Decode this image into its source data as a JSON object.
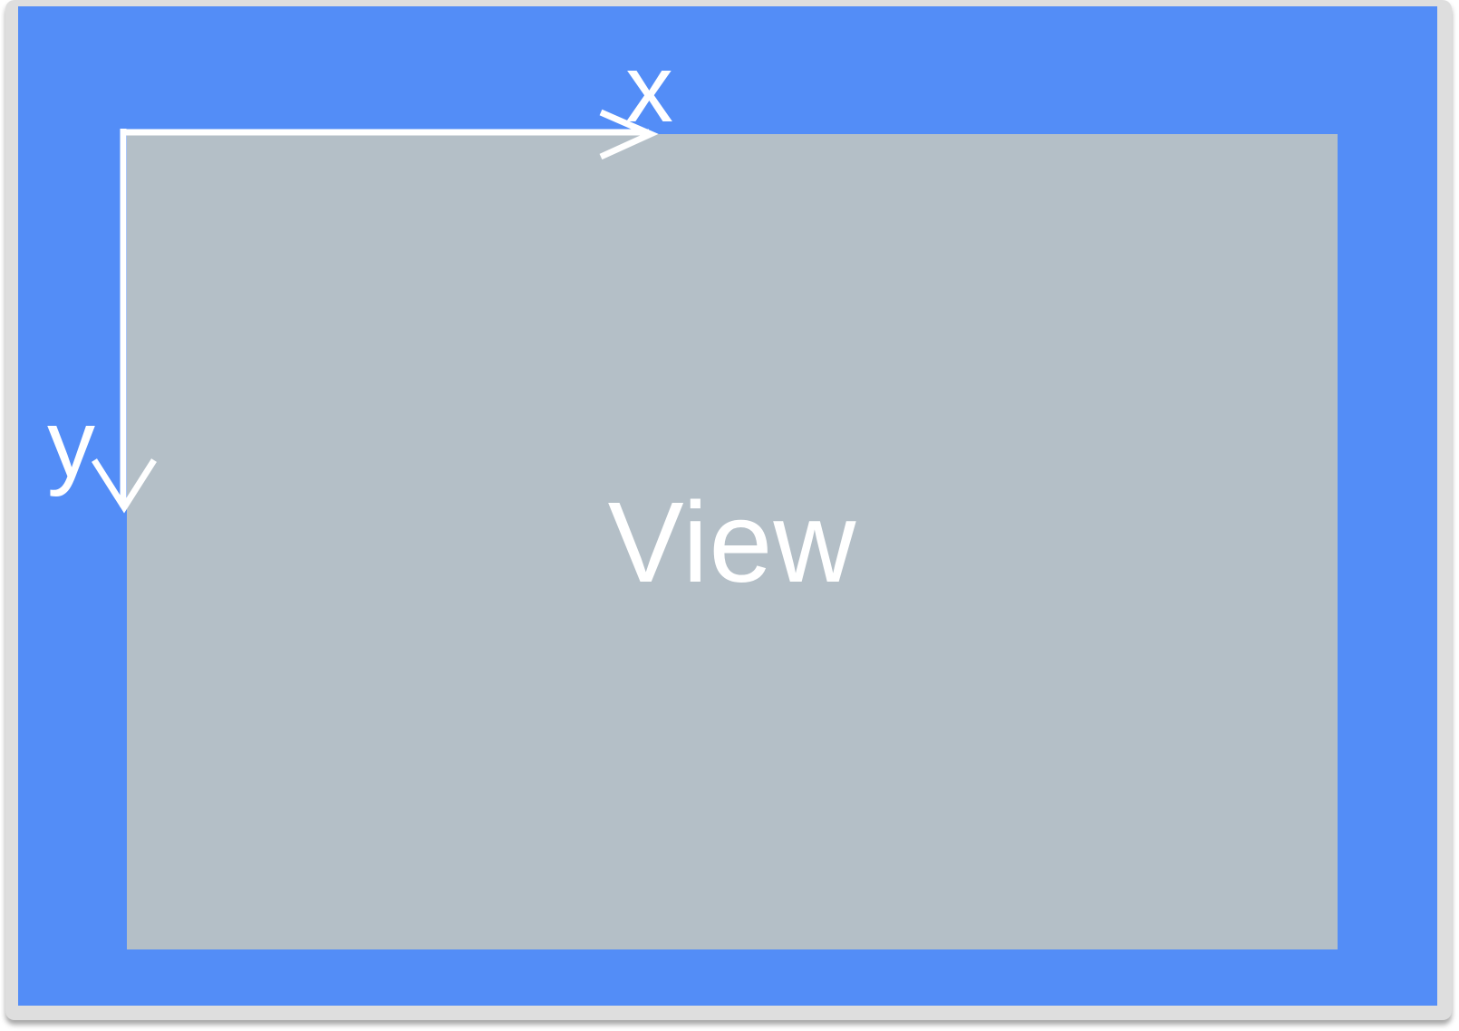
{
  "diagram": {
    "view_label": "View",
    "x_axis_label": "x",
    "y_axis_label": "y",
    "colors": {
      "screen_background": "#538df7",
      "view_background": "#b4bfc7",
      "frame": "#dedede",
      "axis_and_text": "#ffffff"
    }
  }
}
